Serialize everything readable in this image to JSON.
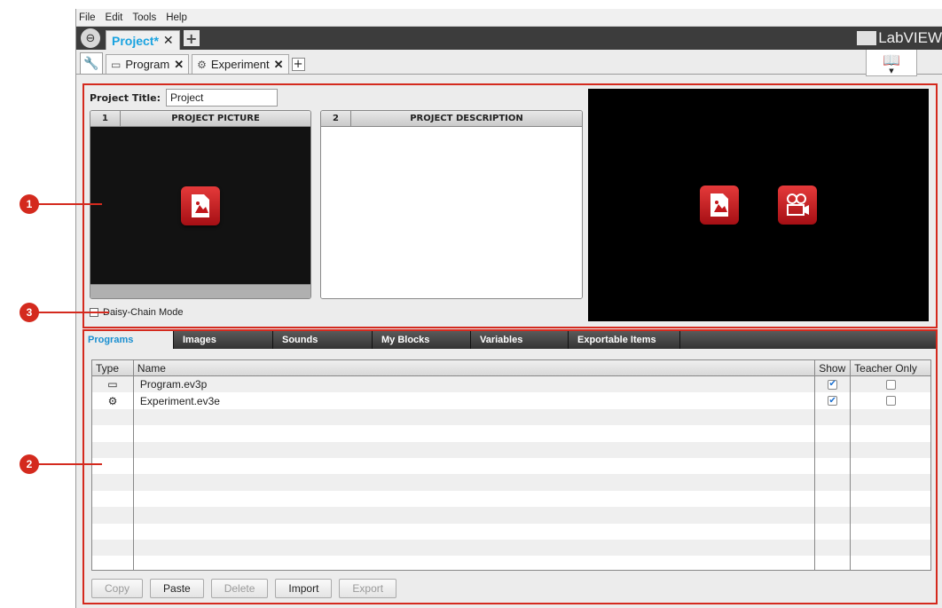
{
  "menu": [
    "File",
    "Edit",
    "Tools",
    "Help"
  ],
  "project_tab": {
    "title": "Project*",
    "close": "✕",
    "add": "+"
  },
  "logo": {
    "text": "LabVIEW"
  },
  "file_tabs": [
    {
      "label": "Program",
      "close": "✕"
    },
    {
      "label": "Experiment",
      "close": "✕"
    }
  ],
  "add_tab": "+",
  "project": {
    "title_label": "Project Title:",
    "title_value": "Project",
    "picture_panel": {
      "number": "1",
      "title": "PROJECT PICTURE"
    },
    "description_panel": {
      "number": "2",
      "title": "PROJECT DESCRIPTION"
    },
    "daisy_chain_label": "Daisy-Chain Mode"
  },
  "bottom_tabs": [
    "Programs",
    "Images",
    "Sounds",
    "My Blocks",
    "Variables",
    "Exportable Items"
  ],
  "table": {
    "columns": [
      "Type",
      "Name",
      "Show",
      "Teacher Only"
    ],
    "rows": [
      {
        "type_icon": "program-icon",
        "name": "Program.ev3p",
        "show": true,
        "teacher_only": false
      },
      {
        "type_icon": "experiment-icon",
        "name": "Experiment.ev3e",
        "show": true,
        "teacher_only": false
      }
    ]
  },
  "buttons": [
    {
      "label": "Copy",
      "enabled": false
    },
    {
      "label": "Paste",
      "enabled": true
    },
    {
      "label": "Delete",
      "enabled": false
    },
    {
      "label": "Import",
      "enabled": true
    },
    {
      "label": "Export",
      "enabled": false
    }
  ],
  "callouts": [
    "1",
    "2",
    "3"
  ],
  "colors": {
    "accent_red": "#d42a1e",
    "tab_blue": "#1aa3e0",
    "dark_bar": "#3c3c3c"
  }
}
